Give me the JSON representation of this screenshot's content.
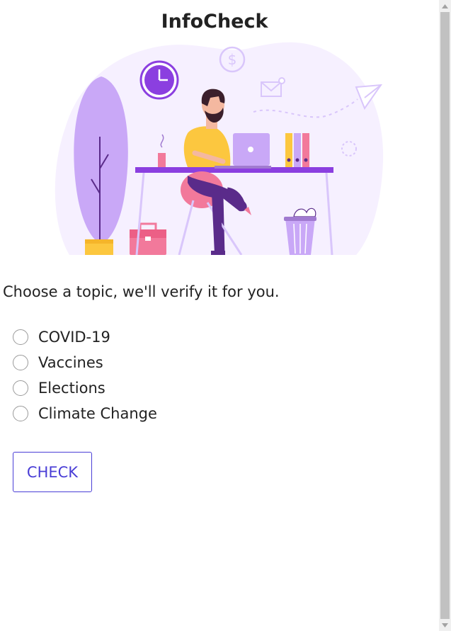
{
  "header": {
    "title": "InfoCheck"
  },
  "hero": {
    "description": ""
  },
  "main": {
    "prompt": "Choose a topic, we'll verify it for you.",
    "options": [
      {
        "label": "COVID-19",
        "checked": false
      },
      {
        "label": "Vaccines",
        "checked": false
      },
      {
        "label": "Elections",
        "checked": false
      },
      {
        "label": "Climate Change",
        "checked": false
      }
    ],
    "check_label": "CHECK"
  },
  "colors": {
    "accent": "#4a3ed6",
    "illustration_purple": "#8b3fe0",
    "illustration_lavender": "#d9c6fb",
    "shirt_yellow": "#fcc73f",
    "pink": "#f2799b"
  }
}
